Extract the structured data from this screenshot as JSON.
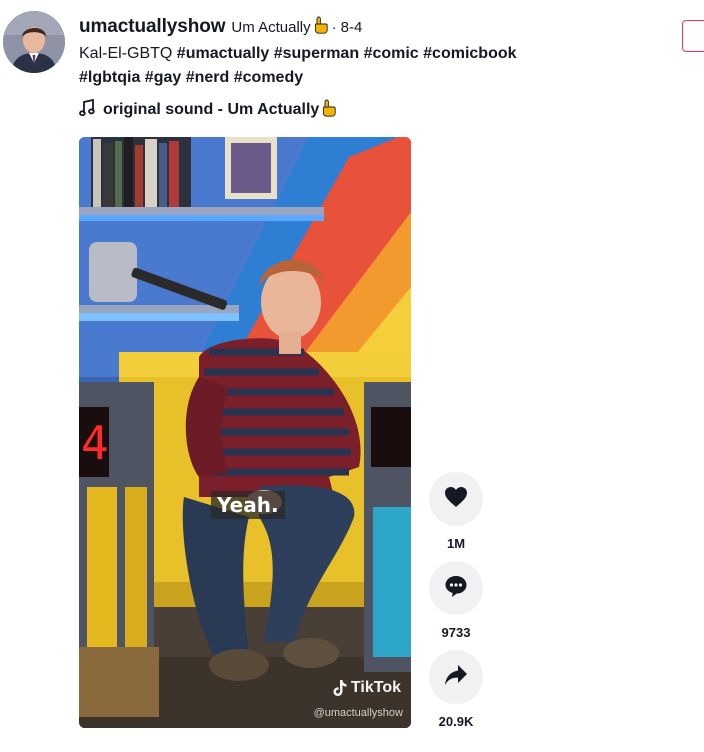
{
  "author": {
    "username": "umactuallyshow",
    "nickname": "Um Actually",
    "separator": "·",
    "date": "8-4"
  },
  "caption": {
    "text": "Kal-El-GBTQ",
    "hashtags": [
      "#umactually",
      "#superman",
      "#comic",
      "#comicbook",
      "#lgbtqia",
      "#gay",
      "#nerd",
      "#comedy"
    ]
  },
  "music": {
    "label": "original sound - Um Actually"
  },
  "video": {
    "subtitle": "Yeah.",
    "watermark_brand": "TikTok",
    "watermark_handle": "@umactuallyshow",
    "scoreboard_digit": "4"
  },
  "actions": {
    "likes": "1M",
    "comments": "9733",
    "shares": "20.9K"
  },
  "colors": {
    "accent": "#fe2c55",
    "hand_emoji": "#f4b400",
    "action_bg": "#f1f1f2"
  },
  "icons": [
    "avatar",
    "pointing-hand-icon",
    "music-note-icon",
    "heart-icon",
    "comment-icon",
    "share-icon",
    "tiktok-logo-icon"
  ]
}
